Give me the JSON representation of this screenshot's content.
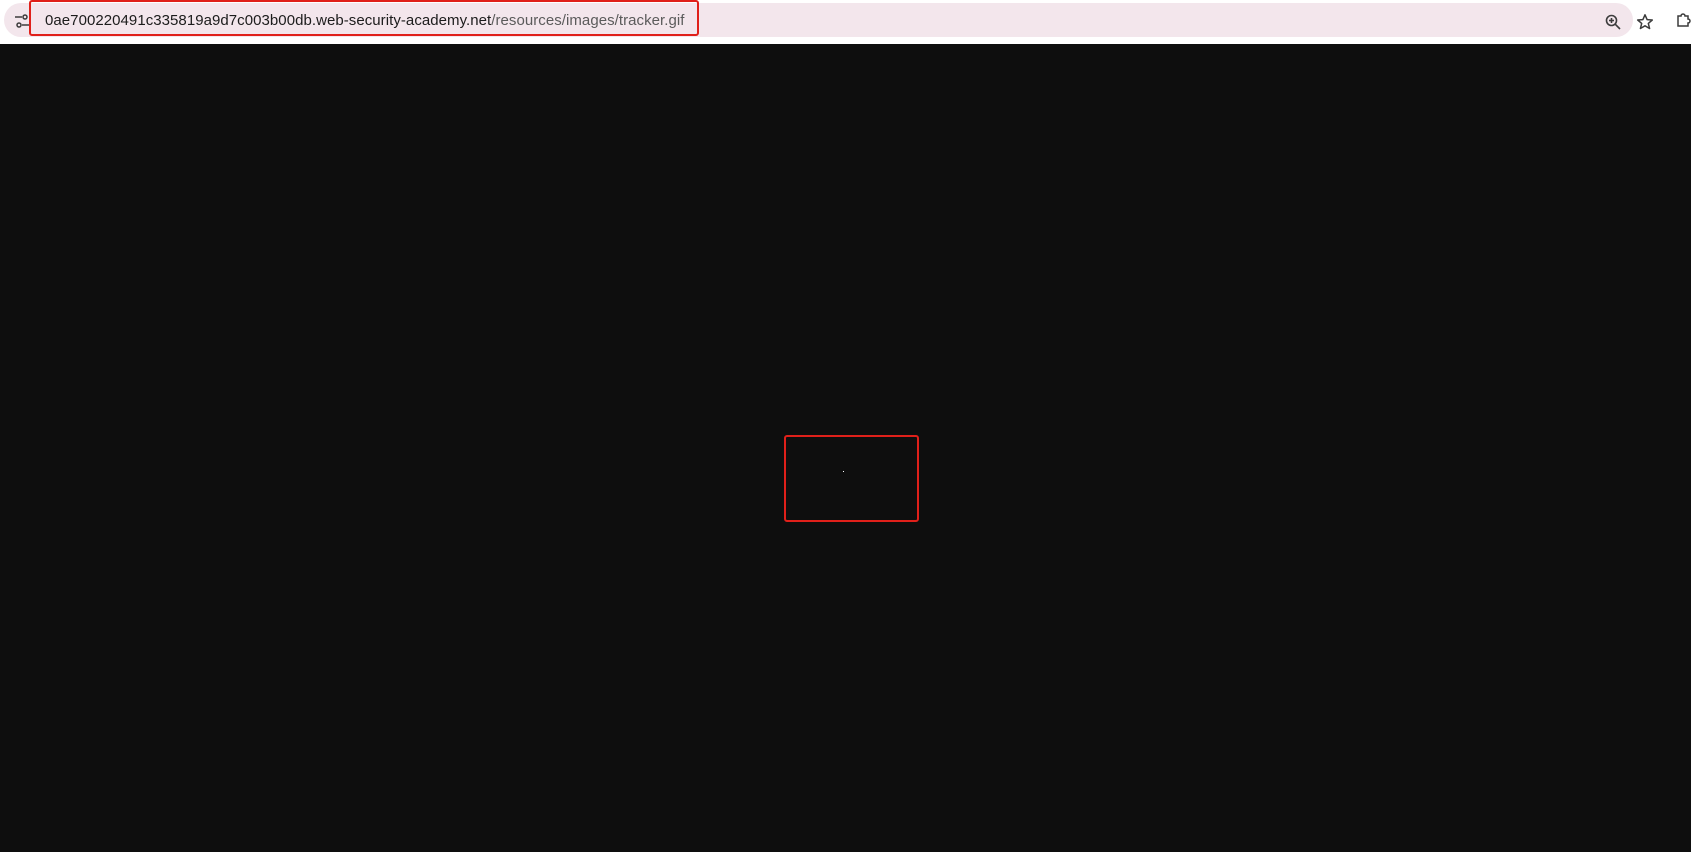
{
  "browser": {
    "address_bar": {
      "url_host": "0ae700220491c335819a9d7c003b00db.web-security-academy.net",
      "url_path": "/resources/images/tracker.gif"
    },
    "icons": {
      "site_info": "tune-icon",
      "zoom": "zoom-in-icon",
      "bookmark": "star-icon",
      "extensions": "puzzle-icon"
    }
  },
  "page": {
    "background_color": "#0e0e0e",
    "content": "tracker-gif-pixel"
  },
  "annotations": {
    "highlight_color": "#e0201a"
  }
}
